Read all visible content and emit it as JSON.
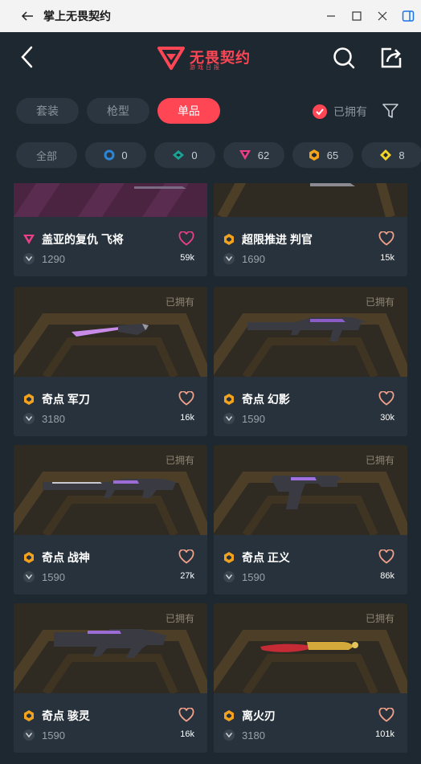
{
  "window": {
    "title": "掌上无畏契约"
  },
  "header": {
    "logo_text": "无畏契约",
    "logo_sub": "游戏日报"
  },
  "tabs": [
    {
      "label": "套装",
      "active": false
    },
    {
      "label": "枪型",
      "active": false
    },
    {
      "label": "单品",
      "active": true
    }
  ],
  "owned_filter": {
    "label": "已拥有",
    "checked": true
  },
  "tiers": [
    {
      "label": "全部",
      "icon": "",
      "color": ""
    },
    {
      "label": "0",
      "icon": "blue-tier-icon",
      "color": "#2b86d6"
    },
    {
      "label": "0",
      "icon": "green-tier-icon",
      "color": "#19a394"
    },
    {
      "label": "62",
      "icon": "pink-tier-icon",
      "color": "#ec3f86"
    },
    {
      "label": "65",
      "icon": "orange-tier-icon",
      "color": "#f2a21c"
    },
    {
      "label": "8",
      "icon": "yellow-tier-icon",
      "color": "#f3d22a"
    }
  ],
  "cards": [
    {
      "name": "盖亚的复仇 飞将",
      "price": "1290",
      "likes": "59k",
      "tier": "pink",
      "owned_tag": "",
      "heart_color": "#ec3f86"
    },
    {
      "name": "超限推进 判官",
      "price": "1690",
      "likes": "15k",
      "tier": "orange",
      "owned_tag": "",
      "heart_color": "#f2a08a"
    },
    {
      "name": "奇点 军刀",
      "price": "3180",
      "likes": "16k",
      "tier": "orange",
      "owned_tag": "已拥有",
      "heart_color": "#f2a08a"
    },
    {
      "name": "奇点 幻影",
      "price": "1590",
      "likes": "30k",
      "tier": "orange",
      "owned_tag": "已拥有",
      "heart_color": "#f2a08a"
    },
    {
      "name": "奇点 战神",
      "price": "1590",
      "likes": "27k",
      "tier": "orange",
      "owned_tag": "已拥有",
      "heart_color": "#f2a08a"
    },
    {
      "name": "奇点 正义",
      "price": "1590",
      "likes": "86k",
      "tier": "orange",
      "owned_tag": "已拥有",
      "heart_color": "#f2a08a"
    },
    {
      "name": "奇点 骇灵",
      "price": "1590",
      "likes": "16k",
      "tier": "orange",
      "owned_tag": "已拥有",
      "heart_color": "#f2a08a"
    },
    {
      "name": "离火刃",
      "price": "3180",
      "likes": "101k",
      "tier": "orange",
      "owned_tag": "已拥有",
      "heart_color": "#f2a08a"
    }
  ]
}
